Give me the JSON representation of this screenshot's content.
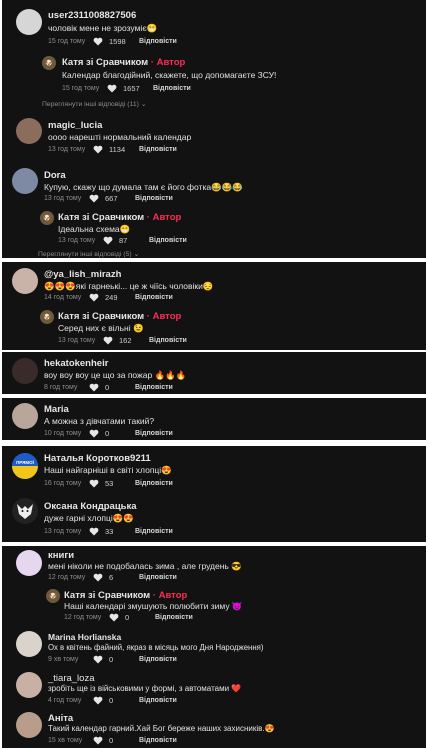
{
  "ui": {
    "reply_label": "Відповісти",
    "author_label": "Автор",
    "author_name": "Катя зі Сравчиком",
    "author_sep": "·",
    "heart_icon": "heart-icon",
    "accent": "#fe2c55"
  },
  "c1": {
    "name": "user2311008827506",
    "text": "чоловік мене не зрозуміє😁",
    "time": "15 год тому",
    "likes": "1598"
  },
  "c1r": {
    "text": "Календар благодійний, скажете, що допомагаєте ЗСУ!",
    "time": "15 год тому",
    "likes": "1657"
  },
  "c1more": "Переглянути інші відповіді (11) ⌄",
  "c2": {
    "name": "magic_lucia",
    "text": "оооо нарешті нормальний календар",
    "time": "13 год тому",
    "likes": "1134"
  },
  "c3": {
    "name": "Dora",
    "text": "Купую, скажу що думала там є його фотка😂😂😂",
    "time": "13 год тому",
    "likes": "667"
  },
  "c3r": {
    "text": "Ідеальна схема😁",
    "time": "13 год тому",
    "likes": "87"
  },
  "c3more": "Переглянути інші відповіді (5) ⌄",
  "c4": {
    "name": "@ya_lish_mirazh",
    "text": "😍😍😍які гарнеькі... це ж чіїсь чоловіки😔",
    "time": "14 год тому",
    "likes": "249"
  },
  "c4r": {
    "text": "Серед них є вільні 😉",
    "time": "13 год тому",
    "likes": "162"
  },
  "c5": {
    "name": "hekatokenheir",
    "text": "воу воу воу це що за пожар 🔥🔥🔥",
    "time": "8 год тому",
    "likes": "0"
  },
  "c6": {
    "name": "Maria",
    "text": "А можна з дівчатами такий?",
    "time": "10 год тому",
    "likes": "0"
  },
  "c7": {
    "name": "Наталья Коротков9211",
    "text": "Наші найгарніші в світі хлопці😍",
    "time": "16 год тому",
    "likes": "53"
  },
  "c8": {
    "name": "Оксана Кондрацька",
    "text": "дуже гарні хлопці😍😍",
    "time": "13 год тому",
    "likes": "33"
  },
  "c9": {
    "name": "книги",
    "text": "мені ніколи не подобалась зима , але грудень 😎",
    "time": "12 год тому",
    "likes": "6"
  },
  "c9r": {
    "text": "Наші календарі змушують полюбити зиму 😈",
    "time": "12 год тому",
    "likes": "0"
  },
  "c10": {
    "name": "Marina Horlianska",
    "text": "Ох в квітень файний, якраз в місяць мого Дня Народження)",
    "time": "9 хв тому",
    "likes": "0"
  },
  "c11": {
    "name": "_tiara_loza",
    "text": "зробіть ще із військовими у формі, з автоматами ❤️",
    "time": "4 год тому",
    "likes": "0"
  },
  "c12": {
    "name": "Аніта",
    "text": "Такий календар гарний.Хай Бог береже наших захисників.😍",
    "time": "15 хв тому",
    "likes": "0"
  }
}
